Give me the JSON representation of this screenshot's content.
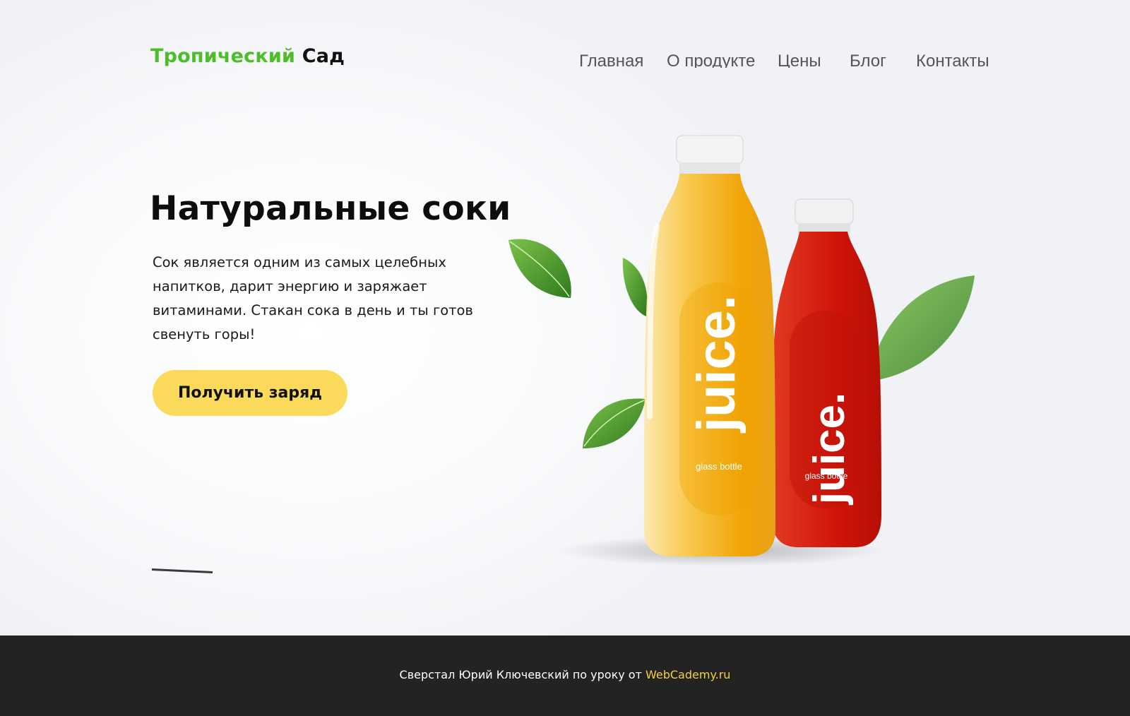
{
  "header": {
    "logo_part1": "Тропический",
    "logo_part2": "Сад",
    "nav": [
      "Главная",
      "О продукте",
      "Цены",
      "Блог",
      "Контакты"
    ]
  },
  "hero": {
    "title": "Натуральные соки",
    "text": "Сок является одним из самых целебных напитков, дарит энергию и заряжает витаминами. Стакан сока в день и ты готов свенуть горы!",
    "button": "Получить заряд"
  },
  "bottles": [
    {
      "brand": "juice.",
      "caption": "glass bottle",
      "color": "#f4a300"
    },
    {
      "brand": "juice.",
      "caption": "glass bottle",
      "color": "#d41b10"
    }
  ],
  "footer": {
    "text": "Сверстал Юрий Ключевский по уроку от",
    "link": "WebCademy.ru"
  },
  "colors": {
    "brand_green": "#4dbd2a",
    "button_yellow": "#fbd95a",
    "footer_bg": "#232323",
    "link_yellow": "#f5cf3c"
  }
}
